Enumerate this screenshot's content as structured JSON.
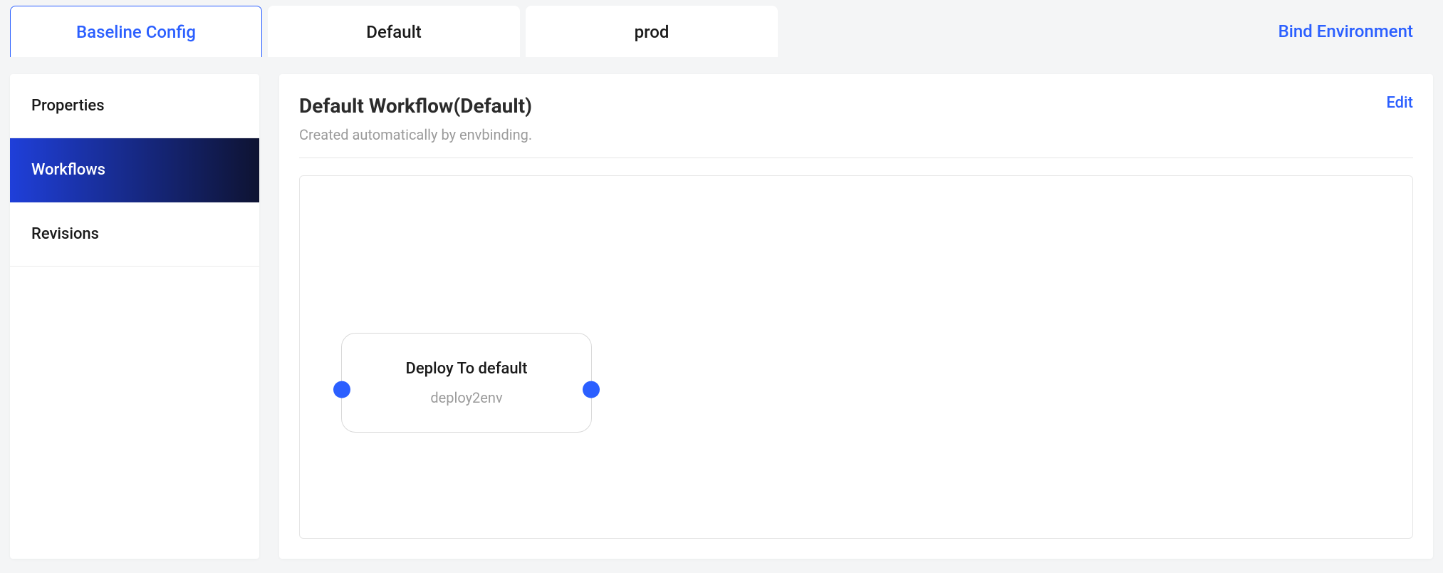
{
  "top_tabs": [
    {
      "label": "Baseline Config",
      "active": true
    },
    {
      "label": "Default",
      "active": false
    },
    {
      "label": "prod",
      "active": false
    }
  ],
  "bind_env_label": "Bind Environment",
  "sidebar": {
    "items": [
      {
        "label": "Properties",
        "active": false
      },
      {
        "label": "Workflows",
        "active": true
      },
      {
        "label": "Revisions",
        "active": false
      }
    ]
  },
  "workflow": {
    "title": "Default Workflow(Default)",
    "subtitle": "Created automatically by envbinding.",
    "edit_label": "Edit",
    "node": {
      "title": "Deploy To default",
      "subtitle": "deploy2env"
    }
  }
}
